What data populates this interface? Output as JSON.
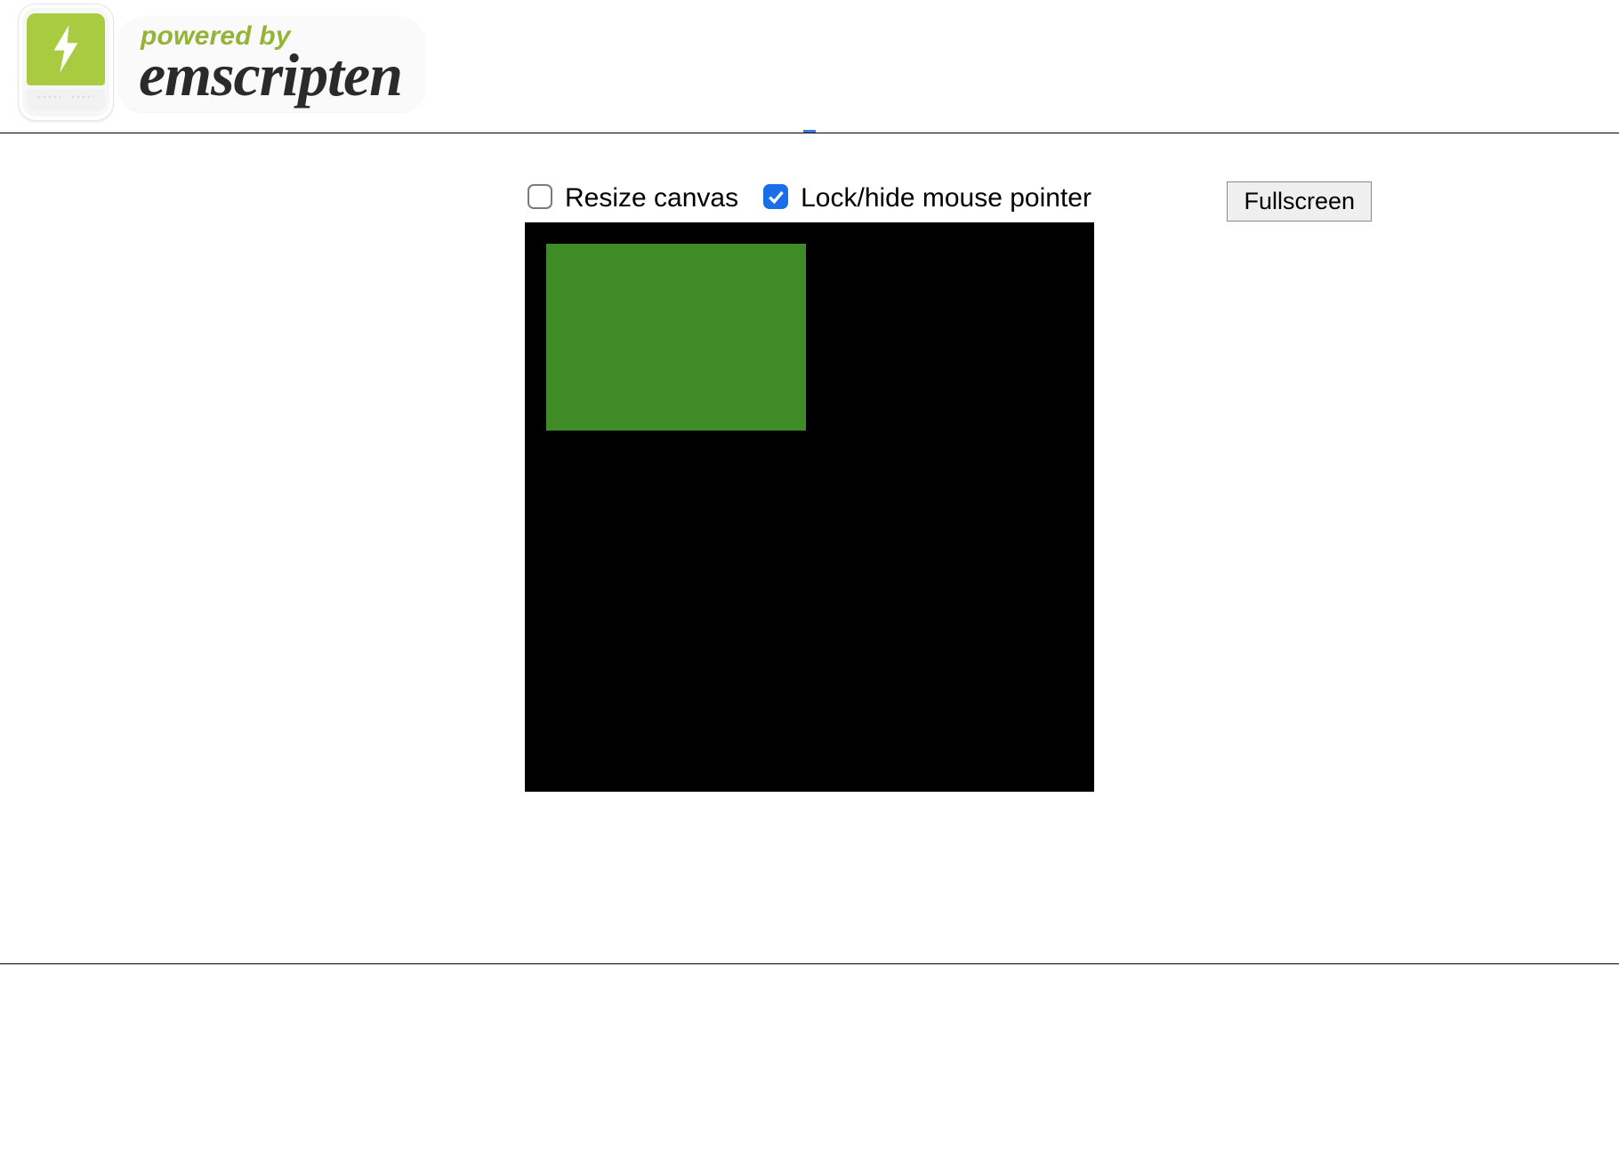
{
  "header": {
    "powered_by": "powered by",
    "name": "emscripten"
  },
  "controls": {
    "resize_label": "Resize canvas",
    "resize_checked": false,
    "pointer_label": "Lock/hide mouse pointer",
    "pointer_checked": true,
    "fullscreen_label": "Fullscreen"
  },
  "canvas": {
    "bg_color": "#000000",
    "rect_color": "#3f8b27"
  }
}
